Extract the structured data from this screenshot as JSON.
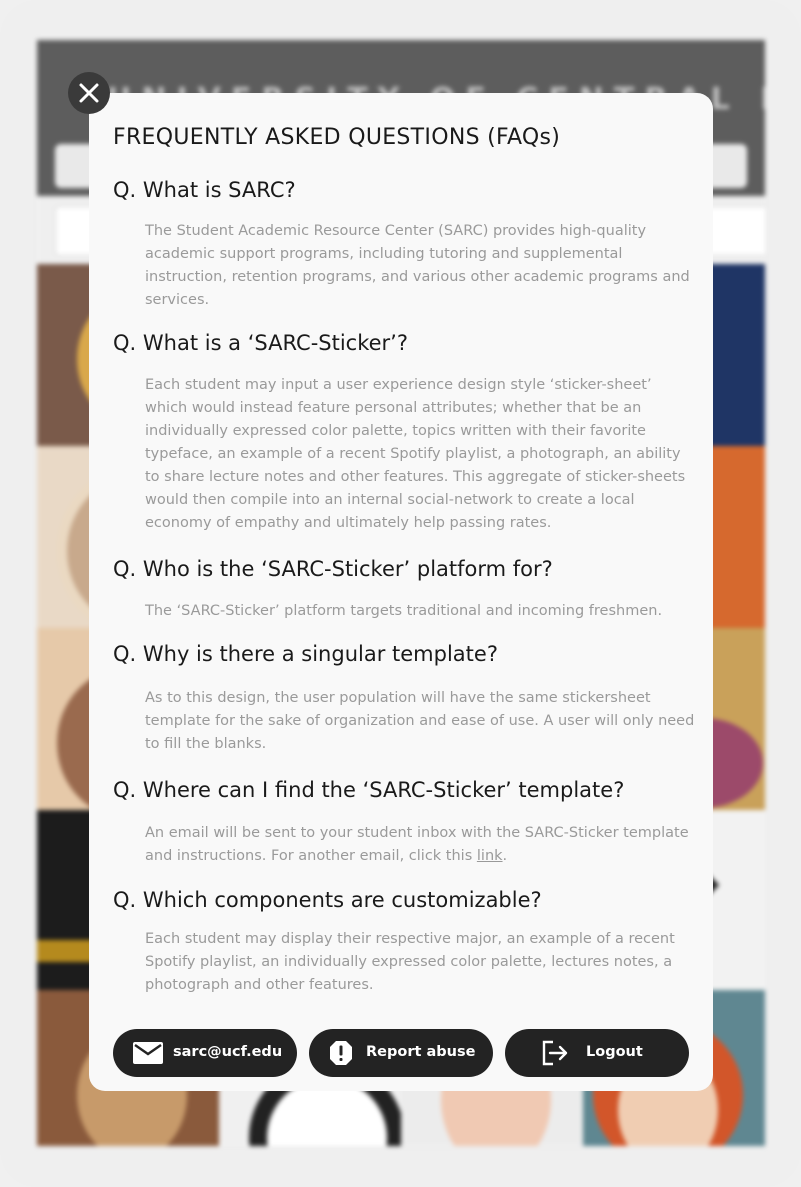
{
  "background": {
    "header_title": "UNIVERSITY OF CENTRAL FLORIDA"
  },
  "modal": {
    "title": "FREQUENTLY ASKED QUESTIONS (FAQs)",
    "close_icon": "close-icon",
    "faqs": [
      {
        "question": "Q. What is SARC?",
        "answer": "The Student Academic Resource Center (SARC) provides high-quality academic support programs, including tutoring and supplemental instruction, retention programs, and various other academic programs and services."
      },
      {
        "question": "Q. What is a ‘SARC-Sticker’?",
        "answer": "Each student may input a user experience design style ‘sticker-sheet’ which would instead feature personal attributes; whether that be an individually expressed color palette, topics written with their favorite typeface, an example of a recent Spotify playlist, a photograph, an ability to share lecture notes and other features. This aggregate of sticker-sheets would then compile into an internal social-network to create a local economy of empathy and ultimately help passing rates."
      },
      {
        "question": "Q. Who is the ‘SARC-Sticker’ platform for?",
        "answer": "The ‘SARC-Sticker’ platform targets traditional and incoming freshmen."
      },
      {
        "question": "Q. Why is there a singular template?",
        "answer": "As to this design, the user population will have the same stickersheet template for the sake of organization and ease of use. A user will only need to fill the blanks."
      },
      {
        "question": "Q. Where can I find the ‘SARC-Sticker’ template?",
        "answer": "An email will be sent to your student inbox with the SARC-Sticker template and instructions. For another email, click this",
        "link_text": "link",
        "answer_tail": "."
      },
      {
        "question": "Q. Which components are customizable?",
        "answer": "Each student may display their respective major, an example of a recent Spotify playlist, an individually expressed color palette, lectures notes, a photograph and other features."
      }
    ],
    "buttons": {
      "email_label": "sarc@ucf.edu",
      "email_icon": "mail-icon",
      "report_label": "Report abuse",
      "report_icon": "alert-icon",
      "logout_label": "Logout",
      "logout_icon": "logout-icon"
    }
  }
}
